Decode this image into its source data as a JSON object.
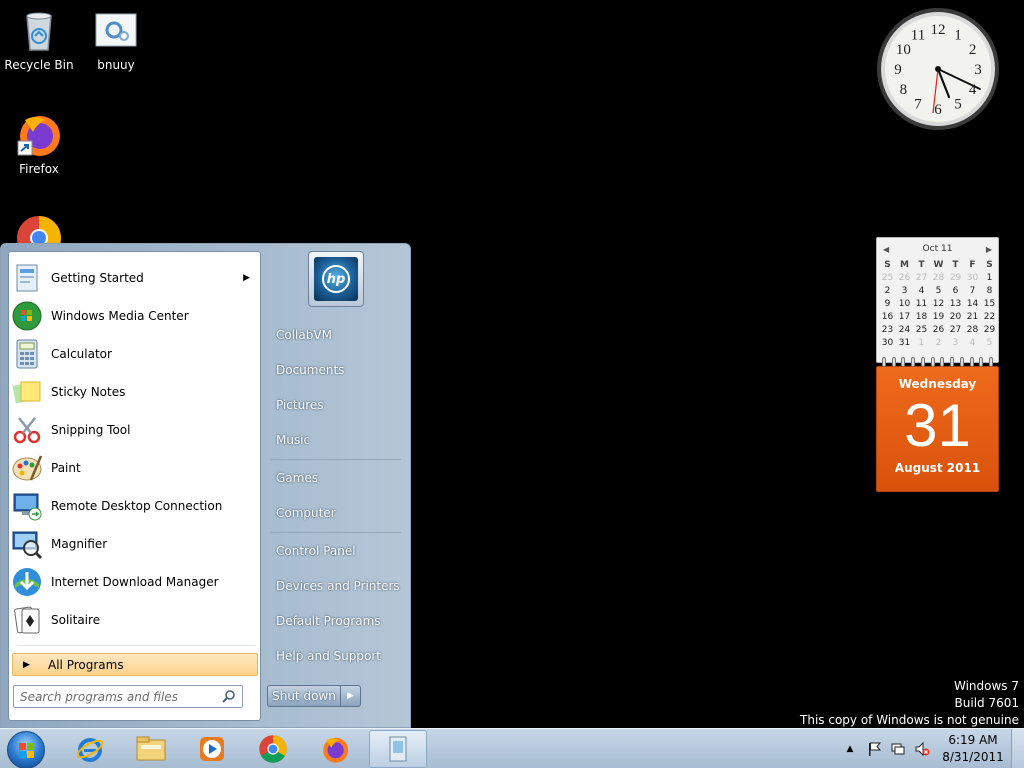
{
  "desktop": {
    "icons": [
      {
        "label": "Recycle Bin",
        "icon": "recycle-bin-icon"
      },
      {
        "label": "bnuuy",
        "icon": "settings-file-icon"
      },
      {
        "label": "Firefox",
        "icon": "firefox-icon"
      },
      {
        "label": "",
        "icon": "chrome-icon"
      }
    ]
  },
  "clock_gadget": {
    "numerals": [
      "12",
      "1",
      "2",
      "3",
      "4",
      "5",
      "6",
      "7",
      "8",
      "9",
      "10",
      "11"
    ],
    "time": "6:19"
  },
  "calendar_gadget": {
    "month_label": "Oct 11",
    "days_of_week": [
      "S",
      "M",
      "T",
      "W",
      "T",
      "F",
      "S"
    ],
    "grid": [
      [
        "25",
        "26",
        "27",
        "28",
        "29",
        "30",
        "1"
      ],
      [
        "2",
        "3",
        "4",
        "5",
        "6",
        "7",
        "8"
      ],
      [
        "9",
        "10",
        "11",
        "12",
        "13",
        "14",
        "15"
      ],
      [
        "16",
        "17",
        "18",
        "19",
        "20",
        "21",
        "22"
      ],
      [
        "23",
        "24",
        "25",
        "26",
        "27",
        "28",
        "29"
      ],
      [
        "30",
        "31",
        "1",
        "2",
        "3",
        "4",
        "5"
      ]
    ],
    "weekday": "Wednesday",
    "day": "31",
    "month_year": "August 2011"
  },
  "watermark": {
    "line1": "Windows 7",
    "line2": "Build 7601",
    "line3": "This copy of Windows is not genuine"
  },
  "start_menu": {
    "programs": [
      {
        "label": "Getting Started",
        "icon": "getting-started-icon",
        "submenu": true
      },
      {
        "label": "Windows Media Center",
        "icon": "media-center-icon",
        "submenu": false
      },
      {
        "label": "Calculator",
        "icon": "calculator-icon",
        "submenu": false
      },
      {
        "label": "Sticky Notes",
        "icon": "sticky-notes-icon",
        "submenu": false
      },
      {
        "label": "Snipping Tool",
        "icon": "snipping-tool-icon",
        "submenu": false
      },
      {
        "label": "Paint",
        "icon": "paint-icon",
        "submenu": false
      },
      {
        "label": "Remote Desktop Connection",
        "icon": "remote-desktop-icon",
        "submenu": false
      },
      {
        "label": "Magnifier",
        "icon": "magnifier-icon",
        "submenu": false
      },
      {
        "label": "Internet Download Manager",
        "icon": "idm-icon",
        "submenu": false
      },
      {
        "label": "Solitaire",
        "icon": "solitaire-icon",
        "submenu": false
      }
    ],
    "all_programs": "All Programs",
    "search_placeholder": "Search programs and files",
    "right_items": [
      "CollabVM",
      "Documents",
      "Pictures",
      "Music",
      "Games",
      "Computer",
      "Control Panel",
      "Devices and Printers",
      "Default Programs",
      "Help and Support"
    ],
    "shutdown": "Shut down"
  },
  "taskbar": {
    "pinned": [
      {
        "name": "internet-explorer",
        "icon": "ie-icon"
      },
      {
        "name": "windows-explorer",
        "icon": "explorer-icon"
      },
      {
        "name": "media-player",
        "icon": "media-player-icon"
      },
      {
        "name": "chrome",
        "icon": "chrome-icon"
      },
      {
        "name": "firefox",
        "icon": "firefox-icon"
      },
      {
        "name": "unknown-app",
        "icon": "app-icon"
      }
    ],
    "time": "6:19 AM",
    "date": "8/31/2011"
  }
}
